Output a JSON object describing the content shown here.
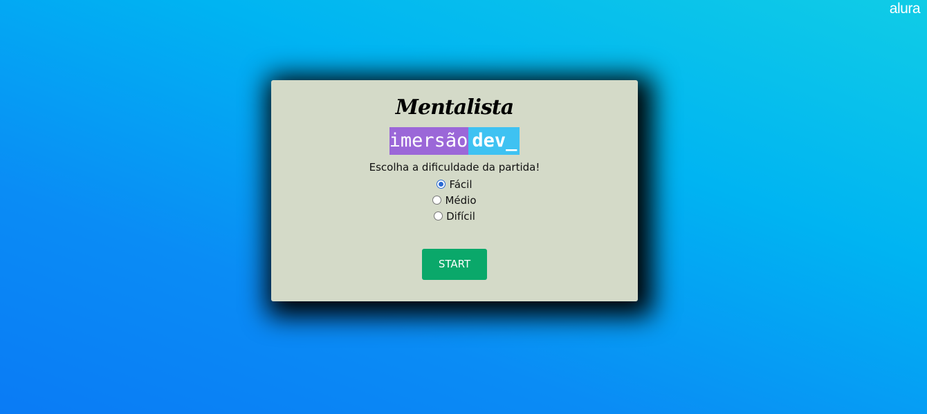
{
  "brand": {
    "logo_text": "alura"
  },
  "card": {
    "title": "Mentalista",
    "badge": {
      "left_text": "imersão",
      "right_text": "dev_"
    },
    "prompt": "Escolha a dificuldade da partida!",
    "options": [
      {
        "label": "Fácil",
        "selected": true
      },
      {
        "label": "Médio",
        "selected": false
      },
      {
        "label": "Difícil",
        "selected": false
      }
    ],
    "start_label": "START"
  },
  "colors": {
    "card_background": "#d4dac8",
    "badge_purple": "#9b67d8",
    "badge_blue": "#3ec2f2",
    "start_button": "#0aa86a"
  }
}
